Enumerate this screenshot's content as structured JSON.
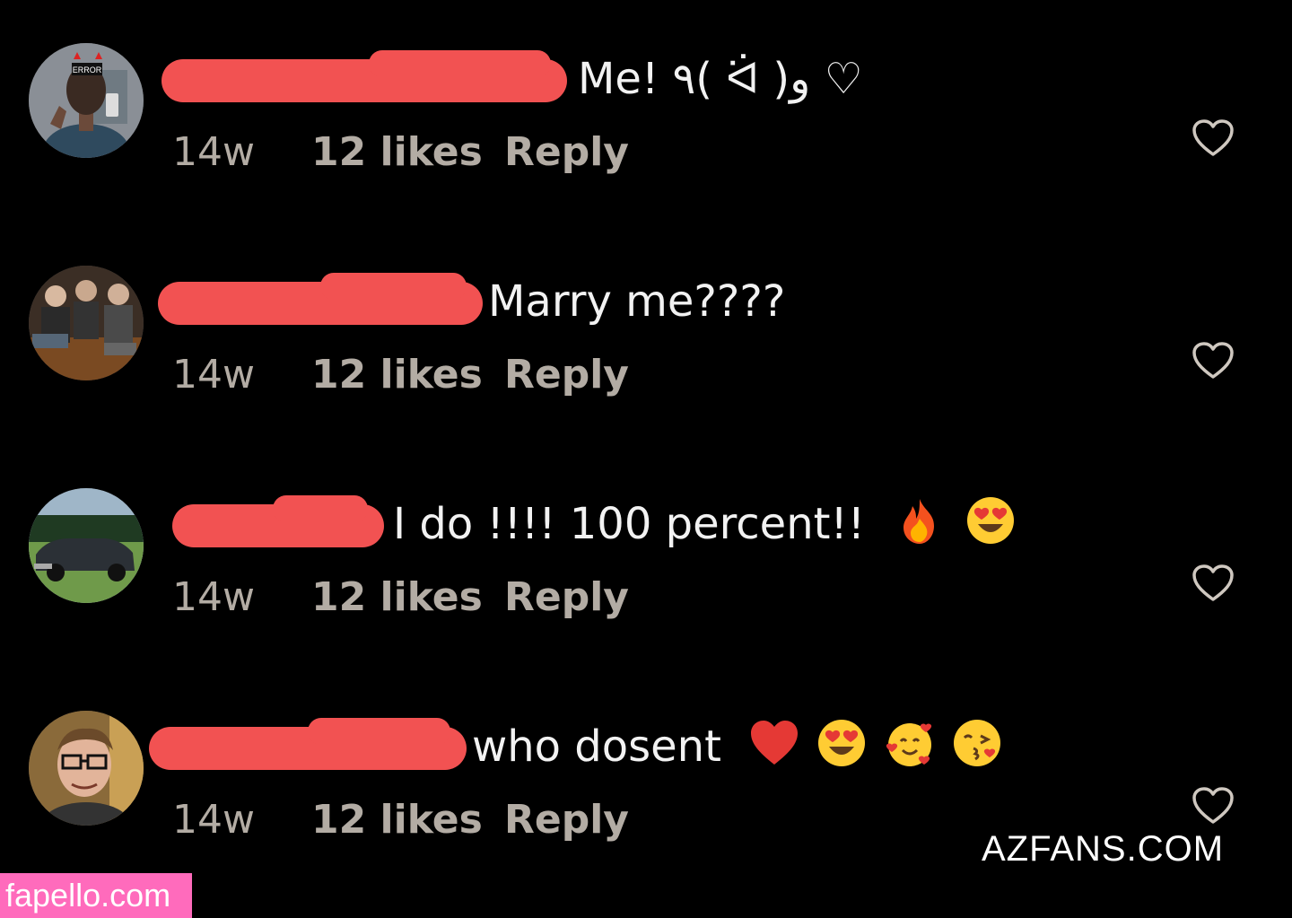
{
  "comments": [
    {
      "text": "Me! ٩( ᐛ )و ♡",
      "time": "14w",
      "likes": "12 likes",
      "reply": "Reply",
      "avatar_badge": "ERROR"
    },
    {
      "text": "Marry me????",
      "time": "14w",
      "likes": "12 likes",
      "reply": "Reply"
    },
    {
      "text": "I do !!!! 100 percent!!",
      "time": "14w",
      "likes": "12 likes",
      "reply": "Reply",
      "emojis": [
        "fire-emoji",
        "heart-eyes-emoji"
      ]
    },
    {
      "text": "who dosent",
      "time": "14w",
      "likes": "12 likes",
      "reply": "Reply",
      "emojis": [
        "red-heart-emoji",
        "heart-eyes-emoji",
        "smiling-face-with-hearts-emoji",
        "kissing-face-emoji"
      ]
    }
  ],
  "watermarks": {
    "azfans": "AZFANS.COM",
    "fapello": "fapello.com"
  },
  "colors": {
    "background": "#000000",
    "redaction": "#f25252",
    "meta_text": "#b3aca4",
    "fapello_bg": "#ff6bbc"
  }
}
